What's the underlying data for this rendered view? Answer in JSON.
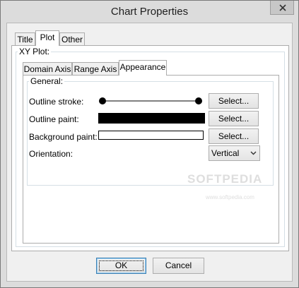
{
  "window": {
    "title": "Chart Properties"
  },
  "tabs": [
    "Title",
    "Plot",
    "Other"
  ],
  "plot": {
    "group_label": "XY Plot:",
    "subtabs": [
      "Domain Axis",
      "Range Axis",
      "Appearance"
    ],
    "general_label": "General:",
    "rows": {
      "outline_stroke": {
        "label": "Outline stroke:",
        "button": "Select..."
      },
      "outline_paint": {
        "label": "Outline paint:",
        "button": "Select...",
        "color": "#000000"
      },
      "background_paint": {
        "label": "Background paint:",
        "button": "Select...",
        "color": "#ffffff"
      },
      "orientation": {
        "label": "Orientation:",
        "value": "Vertical"
      }
    }
  },
  "buttons": {
    "ok": "OK",
    "cancel": "Cancel"
  },
  "watermark": {
    "brand": "SOFTPEDIA",
    "sub": "www.softpedia.com"
  },
  "icons": {
    "close": "close-icon",
    "dropdown": "chevron-down-icon"
  }
}
